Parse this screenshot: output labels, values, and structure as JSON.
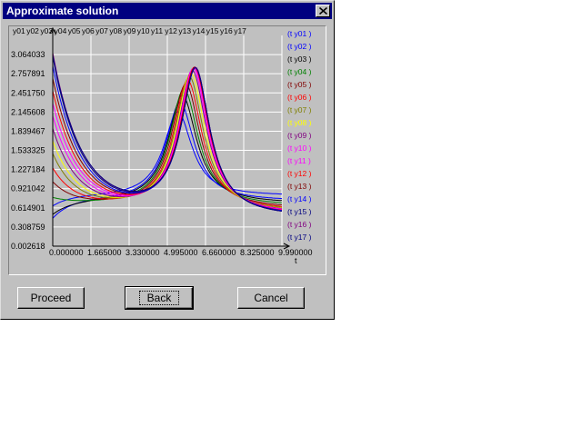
{
  "window": {
    "title": "Approximate solution",
    "close_glyph": "✕"
  },
  "buttons": {
    "proceed": "Proceed",
    "back": "Back",
    "cancel": "Cancel"
  },
  "chart_data": {
    "type": "line",
    "xlabel": "t",
    "top_labels": [
      "y01",
      "y02",
      "y03",
      "y04",
      "y05",
      "y06",
      "y07",
      "y08",
      "y09",
      "y10",
      "y11",
      "y12",
      "y13",
      "y14",
      "y15",
      "y16",
      "y17"
    ],
    "ytick_labels": [
      "0.002618",
      "0.308759",
      "0.614901",
      "0.921042",
      "1.227184",
      "1.533325",
      "1.839467",
      "2.145608",
      "2.451750",
      "2.757891",
      "3.064033"
    ],
    "xtick_labels": [
      "0.000000",
      "1.665000",
      "3.330000",
      "4.995000",
      "6.660000",
      "8.325000",
      "9.990000"
    ],
    "xlim": [
      0,
      9.99
    ],
    "ylim": [
      0.002618,
      3.3702
    ],
    "grid": true,
    "legend_position": "right",
    "series": [
      {
        "name": "(t y01 )",
        "color": "#0000ff",
        "y0": 0.62,
        "mid": 0.78,
        "peak": 2.15,
        "tpeak": 5.45,
        "end": 0.8,
        "t1": 1.6
      },
      {
        "name": "(t y02 )",
        "color": "#0000ff",
        "y0": 0.42,
        "mid": 0.72,
        "peak": 2.3,
        "tpeak": 5.55,
        "end": 0.72,
        "t1": 1.7
      },
      {
        "name": "(t y03 )",
        "color": "#000000",
        "y0": 0.48,
        "mid": 0.7,
        "peak": 2.42,
        "tpeak": 5.65,
        "end": 0.68,
        "t1": 1.8
      },
      {
        "name": "(t y04 )",
        "color": "#008000",
        "y0": 0.75,
        "mid": 0.66,
        "peak": 2.52,
        "tpeak": 5.72,
        "end": 0.64,
        "t1": 1.9
      },
      {
        "name": "(t y05 )",
        "color": "#800000",
        "y0": 1.0,
        "mid": 0.64,
        "peak": 2.6,
        "tpeak": 5.8,
        "end": 0.6,
        "t1": 2.0
      },
      {
        "name": "(t y06 )",
        "color": "#ff0000",
        "y0": 1.22,
        "mid": 0.62,
        "peak": 2.66,
        "tpeak": 5.88,
        "end": 0.57,
        "t1": 2.1
      },
      {
        "name": "(t y07 )",
        "color": "#808000",
        "y0": 1.45,
        "mid": 0.61,
        "peak": 2.72,
        "tpeak": 5.95,
        "end": 0.55,
        "t1": 2.2
      },
      {
        "name": "(t y08 )",
        "color": "#ffff00",
        "y0": 1.65,
        "mid": 0.6,
        "peak": 2.78,
        "tpeak": 6.02,
        "end": 0.53,
        "t1": 2.3
      },
      {
        "name": "(t y09 )",
        "color": "#800080",
        "y0": 1.85,
        "mid": 0.59,
        "peak": 2.82,
        "tpeak": 6.08,
        "end": 0.52,
        "t1": 2.4
      },
      {
        "name": "(t y10 )",
        "color": "#ff00ff",
        "y0": 2.05,
        "mid": 0.58,
        "peak": 2.85,
        "tpeak": 6.12,
        "end": 0.51,
        "t1": 2.5
      },
      {
        "name": "(t y11 )",
        "color": "#ff00ff",
        "y0": 2.25,
        "mid": 0.58,
        "peak": 2.86,
        "tpeak": 6.16,
        "end": 0.5,
        "t1": 2.55
      },
      {
        "name": "(t y12 )",
        "color": "#ff0000",
        "y0": 2.45,
        "mid": 0.57,
        "peak": 2.87,
        "tpeak": 6.18,
        "end": 0.49,
        "t1": 2.6
      },
      {
        "name": "(t y13 )",
        "color": "#800000",
        "y0": 2.65,
        "mid": 0.57,
        "peak": 2.87,
        "tpeak": 6.2,
        "end": 0.48,
        "t1": 2.65
      },
      {
        "name": "(t y14 )",
        "color": "#0000ff",
        "y0": 2.85,
        "mid": 0.56,
        "peak": 2.86,
        "tpeak": 6.22,
        "end": 0.48,
        "t1": 2.7
      },
      {
        "name": "(t y15 )",
        "color": "#000080",
        "y0": 3.0,
        "mid": 0.56,
        "peak": 2.86,
        "tpeak": 6.22,
        "end": 0.47,
        "t1": 2.75
      },
      {
        "name": "(t y16 )",
        "color": "#800080",
        "y0": 3.06,
        "mid": 0.56,
        "peak": 2.86,
        "tpeak": 6.22,
        "end": 0.47,
        "t1": 2.8
      },
      {
        "name": "(t y17 )",
        "color": "#000080",
        "y0": 3.02,
        "mid": 0.56,
        "peak": 2.85,
        "tpeak": 6.22,
        "end": 0.47,
        "t1": 2.85
      }
    ]
  }
}
